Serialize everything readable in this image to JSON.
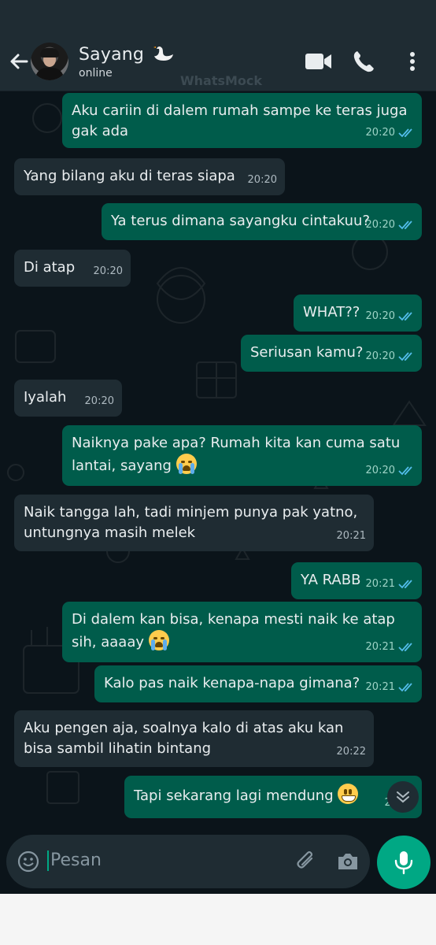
{
  "header": {
    "contact_name": "Sayang",
    "status": "online",
    "watermark": "WhatsMock"
  },
  "icons": {
    "back": "arrow-left-icon",
    "video": "video-call-icon",
    "call": "phone-icon",
    "menu": "more-vertical-icon",
    "emoji": "emoji-icon",
    "attach": "paperclip-icon",
    "camera": "camera-icon",
    "mic": "mic-icon",
    "scroll": "chevron-down-icon",
    "name_emoji": "swan-icon"
  },
  "colors": {
    "background": "#0b141a",
    "header": "#1f2c33",
    "outgoing": "#005c4b",
    "incoming": "#1f2c33",
    "accent": "#00a884",
    "read_ticks": "#53bdeb"
  },
  "messages": [
    {
      "dir": "out",
      "text": "Aku cariin di dalem rumah sampe ke teras juga gak ada",
      "time": "20:20",
      "read": true
    },
    {
      "dir": "in",
      "text": "Yang bilang aku di teras siapa",
      "time": "20:20"
    },
    {
      "dir": "out",
      "text": "Ya terus dimana sayangku cintakuu?",
      "time": "20:20",
      "read": true
    },
    {
      "dir": "in",
      "text": "Di atap",
      "time": "20:20"
    },
    {
      "dir": "out",
      "text": "WHAT??",
      "time": "20:20",
      "read": true
    },
    {
      "dir": "out",
      "text": "Seriusan kamu?",
      "time": "20:20",
      "read": true
    },
    {
      "dir": "in",
      "text": "Iyalah",
      "time": "20:20"
    },
    {
      "dir": "out",
      "text": "Naiknya pake apa? Rumah kita kan cuma satu lantai, sayang",
      "emoji": "crying-face",
      "time": "20:20",
      "read": true
    },
    {
      "dir": "in",
      "text": "Naik tangga lah, tadi minjem punya pak yatno, untungnya masih melek",
      "time": "20:21"
    },
    {
      "dir": "out",
      "text": "YA RABB",
      "time": "20:21",
      "read": true
    },
    {
      "dir": "out",
      "text": "Di dalem kan bisa, kenapa mesti naik ke atap sih, aaaay",
      "emoji": "crying-face",
      "time": "20:21",
      "read": true
    },
    {
      "dir": "out",
      "text": "Kalo pas naik kenapa-napa gimana?",
      "time": "20:21",
      "read": true
    },
    {
      "dir": "in",
      "text": "Aku pengen aja, soalnya kalo di atas aku kan bisa sambil lihatin bintang",
      "time": "20:22"
    },
    {
      "dir": "out",
      "text": "Tapi sekarang lagi mendung",
      "emoji": "grinning-face",
      "time": "20:22",
      "read": true
    }
  ],
  "composer": {
    "placeholder": "Pesan"
  }
}
